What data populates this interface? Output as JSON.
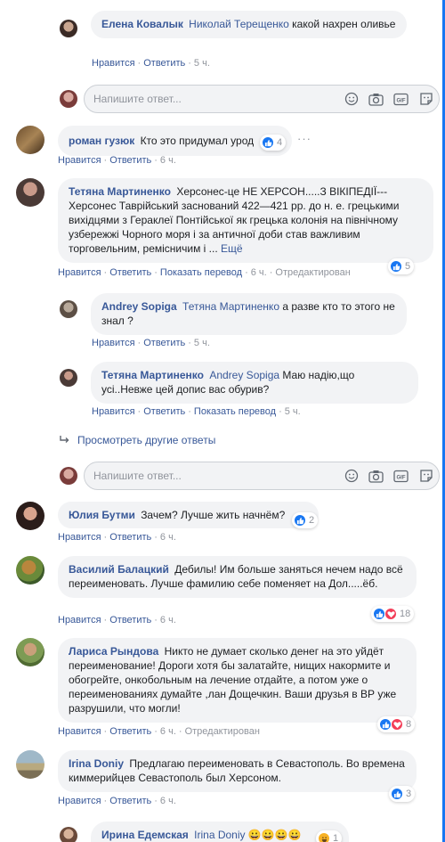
{
  "comments": {
    "c1": {
      "author": "Елена Ковалык",
      "tag": "Николай Терещенко",
      "text": "какой нахрен оливье",
      "like": "Нравится",
      "reply": "Ответить",
      "time": "5 ч."
    },
    "reply_placeholder": "Напишите ответ...",
    "c2": {
      "author": "роман гузюк",
      "text": "Кто это придумал урод",
      "like": "Нравится",
      "reply": "Ответить",
      "time": "6 ч.",
      "reactions": "4"
    },
    "c3": {
      "author": "Тетяна Мартиненко",
      "text": "Херсонес-це НЕ ХЕРСОН.....З ВІКІПЕДІЇ---Херсонес Таврійський заснований 422—421 рр. до н. е. грецькими вихідцями з Гераклеї Понтійської як грецька колонія на північному узбережжі Чорного моря і за античної доби став важливим торговельним, ремісничим і ...",
      "more": "Ещё",
      "like": "Нравится",
      "reply": "Ответить",
      "translate": "Показать перевод",
      "time": "6 ч.",
      "edited": "Отредактирован",
      "reactions": "5"
    },
    "c4": {
      "author": "Andrey Sopiga",
      "tag": "Тетяна Мартиненко",
      "text": "а разве кто то этого не знал ?",
      "like": "Нравится",
      "reply": "Ответить",
      "time": "5 ч."
    },
    "c5": {
      "author": "Тетяна Мартиненко",
      "tag": "Andrey Sopiga",
      "text": "Маю надію,що усі..Невже цей допис вас обурив?",
      "like": "Нравится",
      "reply": "Ответить",
      "translate": "Показать перевод",
      "time": "5 ч."
    },
    "other_replies": "Просмотреть другие ответы",
    "c6": {
      "author": "Юлия Бутми",
      "text": "Зачем? Лучше жить начнём?",
      "like": "Нравится",
      "reply": "Ответить",
      "time": "6 ч.",
      "reactions": "2"
    },
    "c7": {
      "author": "Василий Балацкий",
      "text": "Дебилы! Им больше заняться нечем надо всё переименовать. Лучше фамилию себе поменяет на Дол.....ёб.",
      "like": "Нравится",
      "reply": "Ответить",
      "time": "6 ч.",
      "reactions": "18"
    },
    "c8": {
      "author": "Лариса Рындова",
      "text": "Никто не думает сколько денег на это уйдёт переименование! Дороги хотя бы залатайте, нищих накормите и обогрейте, онкобольным на лечение отдайте, а потом уже о переименованиях думайте ,лан Дощечкин. Ваши друзья в ВР уже разрушили, что могли!",
      "like": "Нравится",
      "reply": "Ответить",
      "time": "6 ч.",
      "edited": "Отредактирован",
      "reactions": "8"
    },
    "c9": {
      "author": "Irina Doniy",
      "text": "Предлагаю переименовать в Севастополь. Во времена киммерийцев Севастополь был Херсоном.",
      "like": "Нравится",
      "reply": "Ответить",
      "time": "6 ч.",
      "reactions": "3"
    },
    "c10": {
      "author": "Ирина Едемская",
      "tag": "Irina Doniy",
      "emoji": "😀😀😀😀",
      "reactions": "1"
    }
  },
  "colors": {
    "link": "#385898",
    "like": "#1877f2",
    "love": "#f33e58",
    "bubble": "#f2f3f5",
    "meta": "#90949c"
  }
}
